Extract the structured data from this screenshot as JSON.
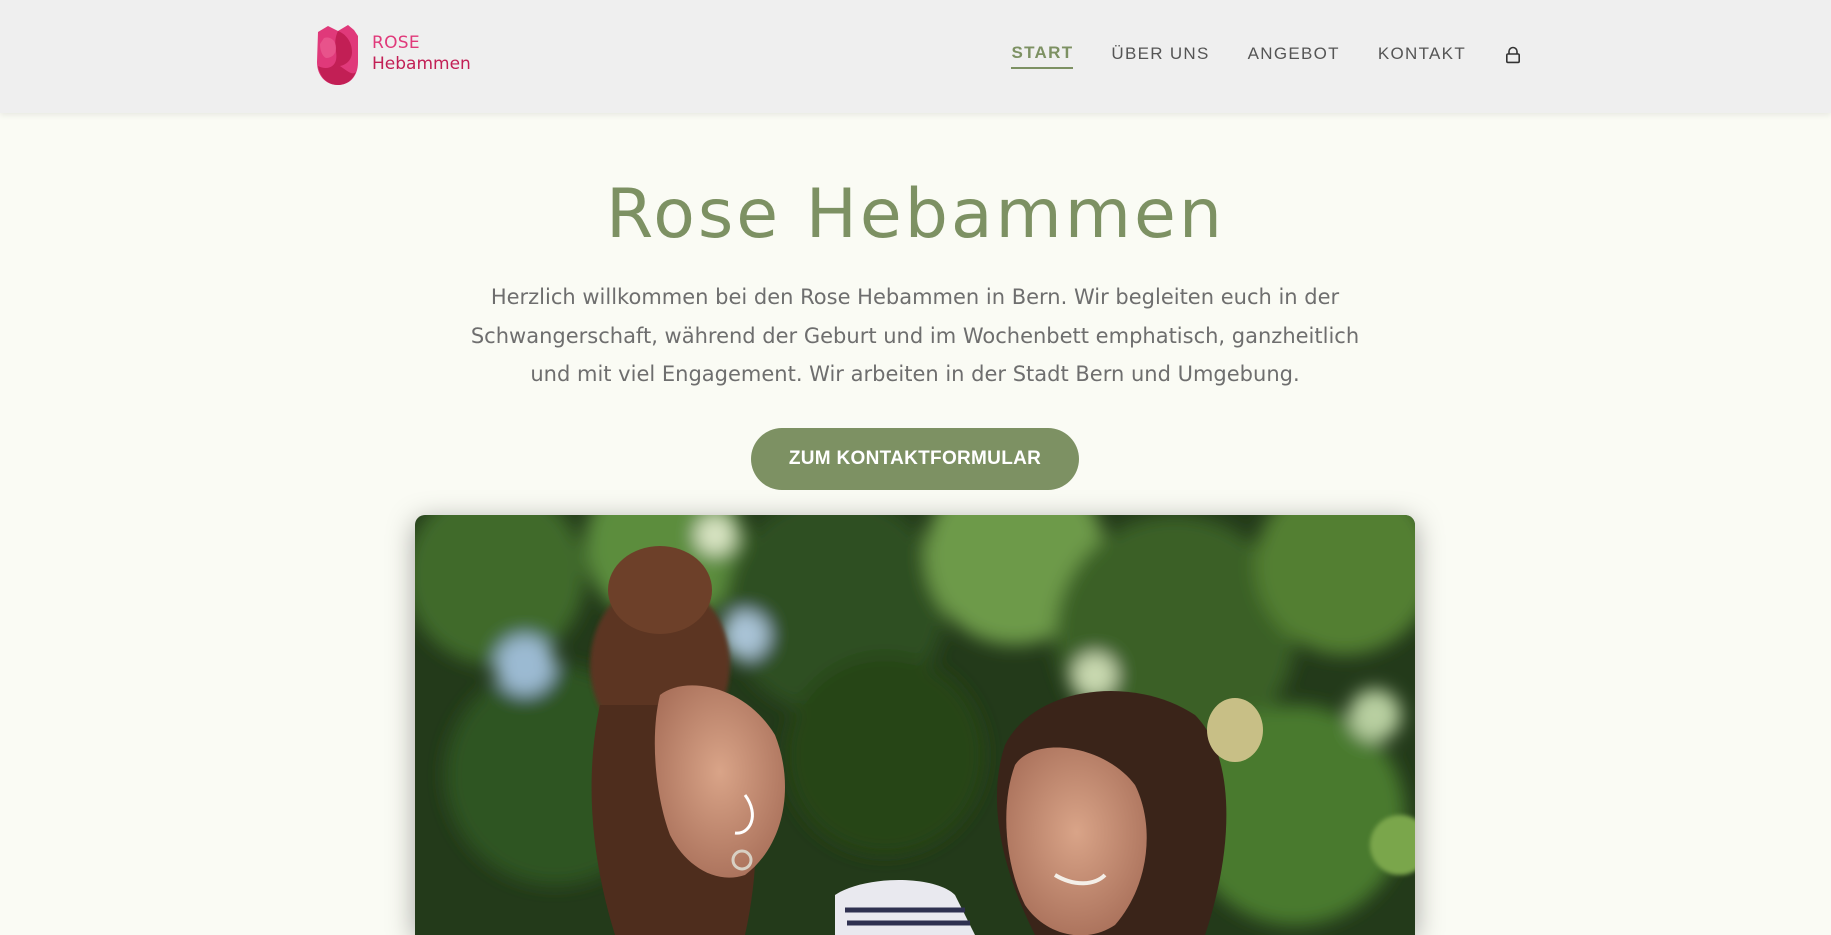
{
  "brand": {
    "line1": "ROSE",
    "line2": "Hebammen",
    "colors": {
      "primary": "#e0397a",
      "dark": "#c21f55"
    }
  },
  "nav": {
    "items": [
      {
        "label": "START",
        "active": true
      },
      {
        "label": "ÜBER UNS",
        "active": false
      },
      {
        "label": "ANGEBOT",
        "active": false
      },
      {
        "label": "KONTAKT",
        "active": false
      }
    ],
    "lock_icon": "lock-icon"
  },
  "hero": {
    "title": "Rose Hebammen",
    "text": "Herzlich willkommen bei den Rose Hebammen in Bern. Wir begleiten euch in der Schwangerschaft, während der Geburt und im Wochenbett emphatisch, ganzheitlich und mit viel Engagement. Wir arbeiten in der Stadt Bern und Umgebung.",
    "cta_label": "ZUM KONTAKTFORMULAR"
  },
  "theme": {
    "accent": "#7d9163",
    "background": "#fafbf4",
    "header_bg": "#efefef",
    "text": "#6e6e6e"
  }
}
